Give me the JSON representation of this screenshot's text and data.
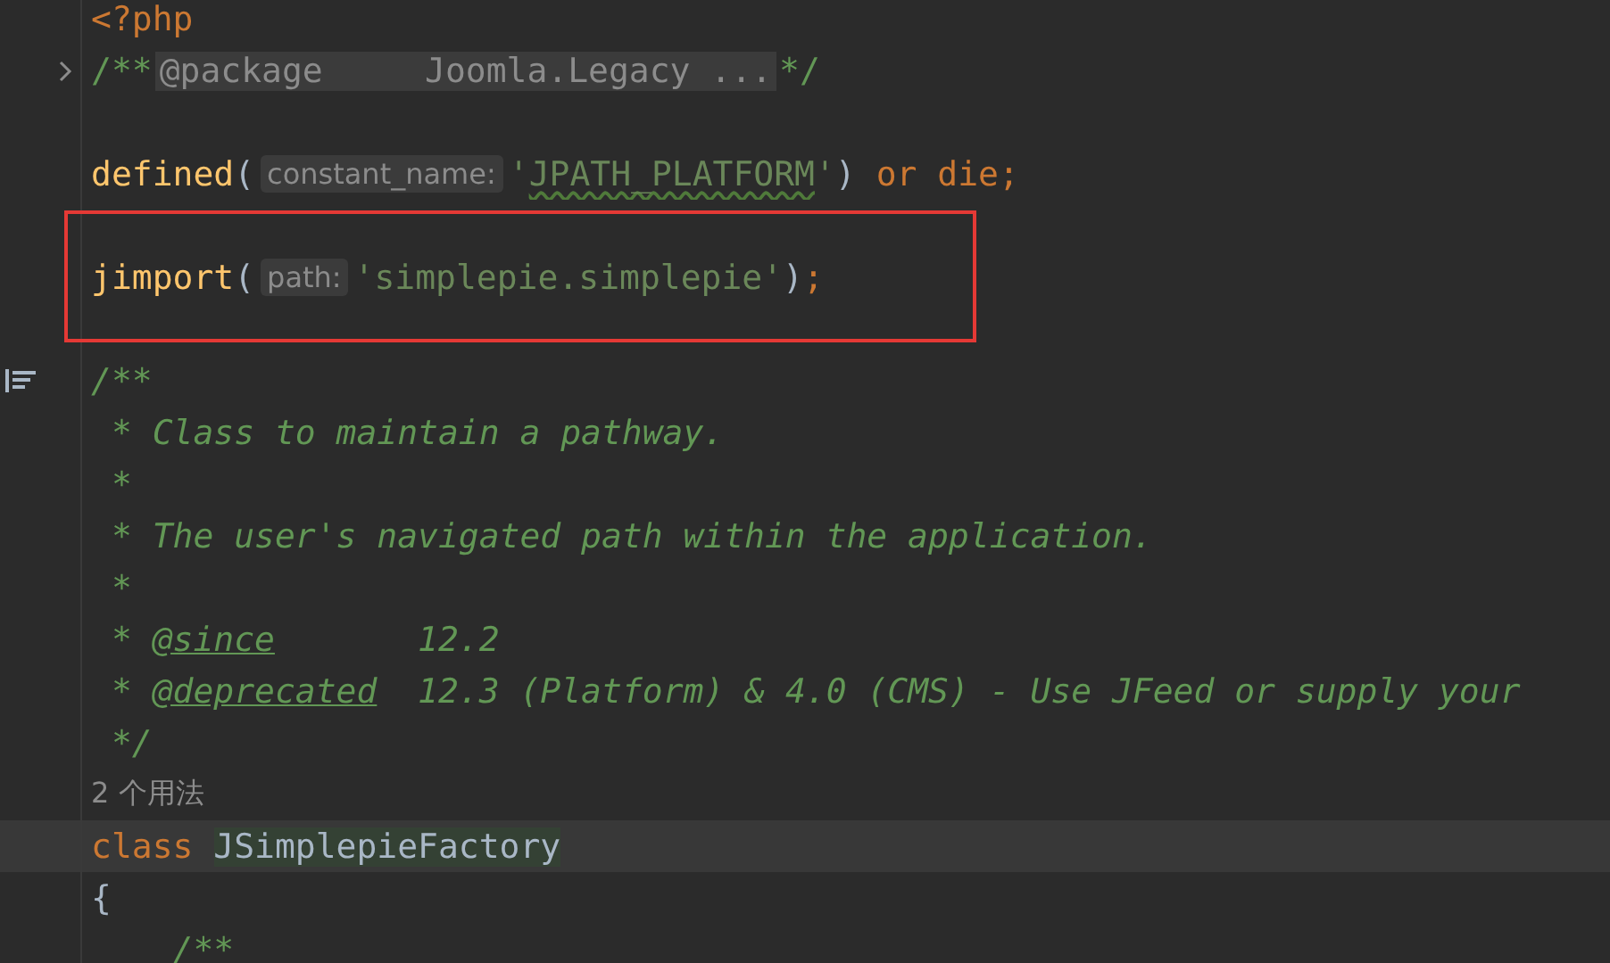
{
  "blocks": [
    {
      "kind": "plain",
      "lines": [
        {
          "current": false,
          "tokens": [
            {
              "kind": "tag",
              "text": "<?php"
            }
          ]
        },
        {
          "gutter": {
            "kind": "fold"
          },
          "current": false,
          "tokens": [
            {
              "kind": "comment-plain",
              "text": "/**"
            },
            {
              "kind": "folded",
              "text": "@package     Joomla.Legacy ..."
            },
            {
              "kind": "comment-plain",
              "text": "*/"
            }
          ]
        },
        {
          "current": false
        },
        {
          "current": false,
          "tokens": [
            {
              "kind": "function",
              "text": "defined"
            },
            {
              "kind": "punct",
              "text": "("
            },
            {
              "kind": "hint",
              "text": "constant_name:"
            },
            {
              "kind": "string",
              "text": "'"
            },
            {
              "kind": "string-typo",
              "text": "JPATH_PLATFORM"
            },
            {
              "kind": "string",
              "text": "'"
            },
            {
              "kind": "punct",
              "text": ")"
            },
            {
              "kind": "keyword",
              "text": " or die;"
            }
          ]
        }
      ]
    },
    {
      "kind": "marked",
      "lines": [
        {
          "current": false
        },
        {
          "current": false,
          "tokens": [
            {
              "kind": "function",
              "text": "jimport"
            },
            {
              "kind": "punct",
              "text": "("
            },
            {
              "kind": "hint",
              "text": "path:"
            },
            {
              "kind": "string",
              "text": "'simplepie.simplepie'"
            },
            {
              "kind": "punct",
              "text": ")"
            },
            {
              "kind": "keyword",
              "text": ";"
            }
          ]
        },
        {
          "current": false
        }
      ]
    },
    {
      "kind": "plain",
      "lines": [
        {
          "gutter": {
            "kind": "doc"
          },
          "current": false,
          "tokens": [
            {
              "kind": "comment",
              "text": "/**"
            }
          ]
        },
        {
          "current": false,
          "tokens": [
            {
              "kind": "comment",
              "text": " * Class to maintain a pathway."
            }
          ]
        },
        {
          "current": false,
          "tokens": [
            {
              "kind": "comment",
              "text": " *"
            }
          ]
        },
        {
          "current": false,
          "tokens": [
            {
              "kind": "comment",
              "text": " * The user's navigated path within the application."
            }
          ]
        },
        {
          "current": false,
          "tokens": [
            {
              "kind": "comment",
              "text": " *"
            }
          ]
        },
        {
          "current": false,
          "tokens": [
            {
              "kind": "comment",
              "text": " * "
            },
            {
              "kind": "doc-tag",
              "text": "@since"
            },
            {
              "kind": "comment",
              "text": "       12.2"
            }
          ]
        },
        {
          "current": false,
          "tokens": [
            {
              "kind": "comment",
              "text": " * "
            },
            {
              "kind": "doc-tag",
              "text": "@deprecated"
            },
            {
              "kind": "comment",
              "text": "  12.3 (Platform) & 4.0 (CMS) - Use JFeed or supply your"
            }
          ]
        },
        {
          "current": false,
          "tokens": [
            {
              "kind": "comment",
              "text": " */"
            }
          ]
        },
        {
          "current": false,
          "tokens": [
            {
              "kind": "usage",
              "text": "2 个用法"
            }
          ]
        },
        {
          "current": true,
          "tokens": [
            {
              "kind": "keyword",
              "text": "class "
            },
            {
              "kind": "class-name",
              "text": "JSimplepieFactory"
            }
          ]
        },
        {
          "current": false,
          "tokens": [
            {
              "kind": "punct",
              "text": "{"
            }
          ]
        },
        {
          "current": false,
          "tokens": [
            {
              "kind": "comment",
              "text": "    /**"
            }
          ]
        }
      ]
    }
  ]
}
